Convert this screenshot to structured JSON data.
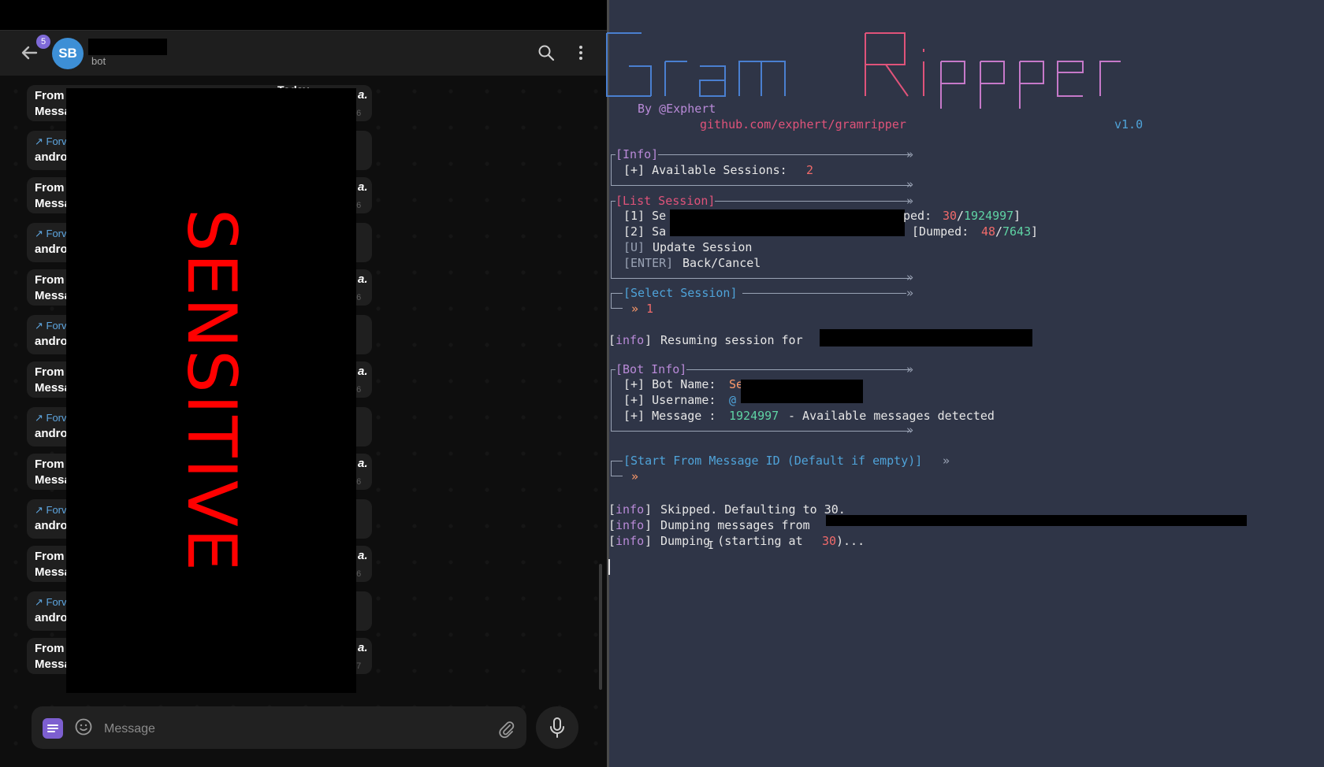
{
  "telegram": {
    "unread_count": "5",
    "avatar_initials": "SB",
    "chat_subtitle": "bot",
    "overlay_label": "SENSITIVE",
    "message_prefix_from": "From",
    "message_prefix_messa": "Messa",
    "forward_label": "Forv",
    "forward_sender": "andro",
    "header_fragment": "Today",
    "italic_fragment": "a.",
    "time_fragment_a": "56",
    "time_fragment_b": "57",
    "composer_placeholder": "Message",
    "icons": [
      "back-arrow-icon",
      "search-icon",
      "more-vertical-icon",
      "sticker-icon",
      "emoji-icon",
      "attach-icon",
      "mic-icon"
    ]
  },
  "terminal": {
    "banner_author": "By @Exphert",
    "banner_repo": "github.com/exphert/gramripper",
    "banner_version": "v1.0",
    "info_header": "[Info]",
    "info_sessions_label": "[+] Available Sessions:",
    "info_sessions_value": "2",
    "list_header": "[List Session]",
    "list_1_prefix": "[1] Se",
    "list_1_suffix": "ped:",
    "list_1_dumped": "30",
    "list_1_total": "1924997",
    "list_2_prefix": "[2] Sa",
    "list_2_dumped_label": "[Dumped:",
    "list_2_dumped": "48",
    "list_2_total": "7643",
    "list_update_key": "[U]",
    "list_update_label": "Update Session",
    "list_enter_key": "[ENTER]",
    "list_enter_label": "Back/Cancel",
    "select_header": "[Select Session]",
    "select_value": "1",
    "resuming_tag": "[info]",
    "resuming_text": "Resuming session for",
    "bot_header": "[Bot Info]",
    "bot_name_label": "[+] Bot Name:",
    "bot_name_partial": "Se",
    "bot_username_label": "[+] Username:",
    "bot_username_partial": "@",
    "bot_message_label": "[+] Message :",
    "bot_message_count": "1924997",
    "bot_message_suffix": "- Available messages detected",
    "start_header": "[Start From Message ID (Default if empty)]",
    "log_1": "Skipped. Defaulting to 30.",
    "log_2": "Dumping messages from",
    "log_3_prefix": "Dumping (starting at",
    "log_3_value": "30",
    "log_3_suffix": ")..."
  },
  "colors": {
    "terminal_bg": "#2f3547",
    "accent_blue": "#4fa3d9",
    "accent_pink": "#e0537a",
    "accent_purple": "#b98ad8",
    "accent_green": "#5fd3a4",
    "accent_orange": "#ff9a6a",
    "telegram_bg": "#0e0e0e",
    "sensitive_red": "#ff0000"
  }
}
